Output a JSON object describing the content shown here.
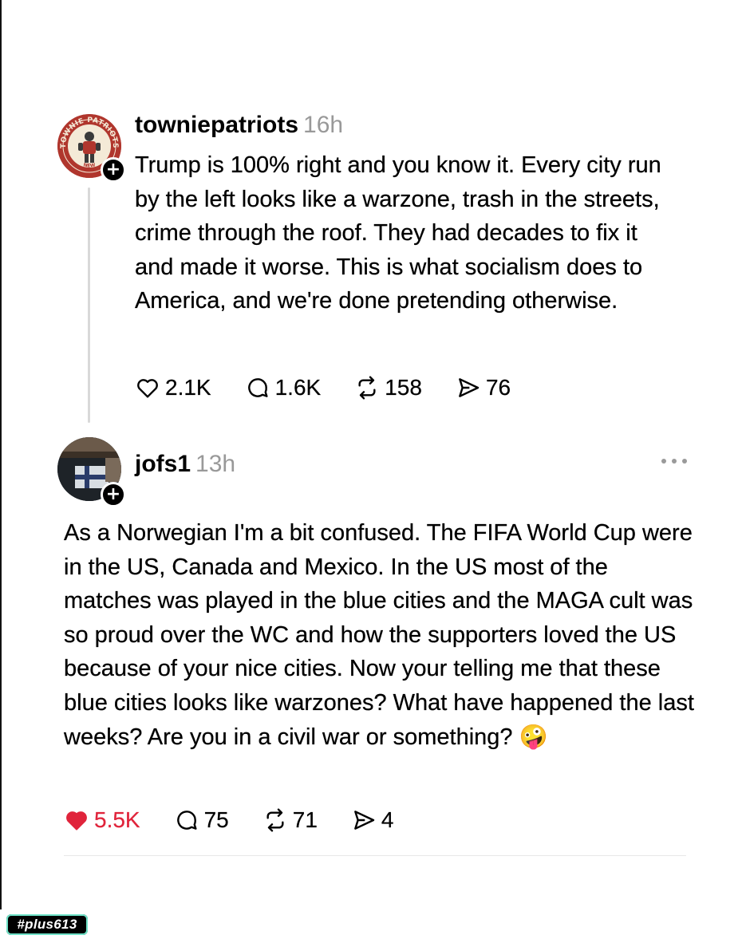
{
  "post1": {
    "username": "towniepatriots",
    "time": "16h",
    "avatar_logo_text": "TOWNIE PATRIOTS",
    "avatar_logo_sub": "NEW",
    "text": "Trump is 100% right and you know it. Every city run by the left looks like a warzone, trash in the streets, crime through the roof. They had decades to fix it and made it worse. This is what socialism does to America, and we're done pretending otherwise.",
    "likes": "2.1K",
    "replies": "1.6K",
    "reposts": "158",
    "shares": "76",
    "liked": false
  },
  "post2": {
    "username": "jofs1",
    "time": "13h",
    "text": "As a Norwegian I'm a bit confused. The FIFA World Cup were in the US, Canada and Mexico. In the US most of the matches was played in the blue cities and the MAGA cult was so proud over the WC and how the supporters loved the US because of your nice cities. Now your telling me that these blue cities looks like warzones? What have happened the last weeks? Are you in a civil war or something?",
    "emoji": "🤪",
    "likes": "5.5K",
    "replies": "75",
    "reposts": "71",
    "shares": "4",
    "liked": true
  },
  "follow_badge": "+",
  "watermark": "#plus613",
  "colors": {
    "like_active": "#e0243b",
    "timestamp": "#999999",
    "avatar_brand": "#b0362d",
    "thread_line": "#d9d9d9",
    "watermark_outline": "#6fe3c8"
  }
}
